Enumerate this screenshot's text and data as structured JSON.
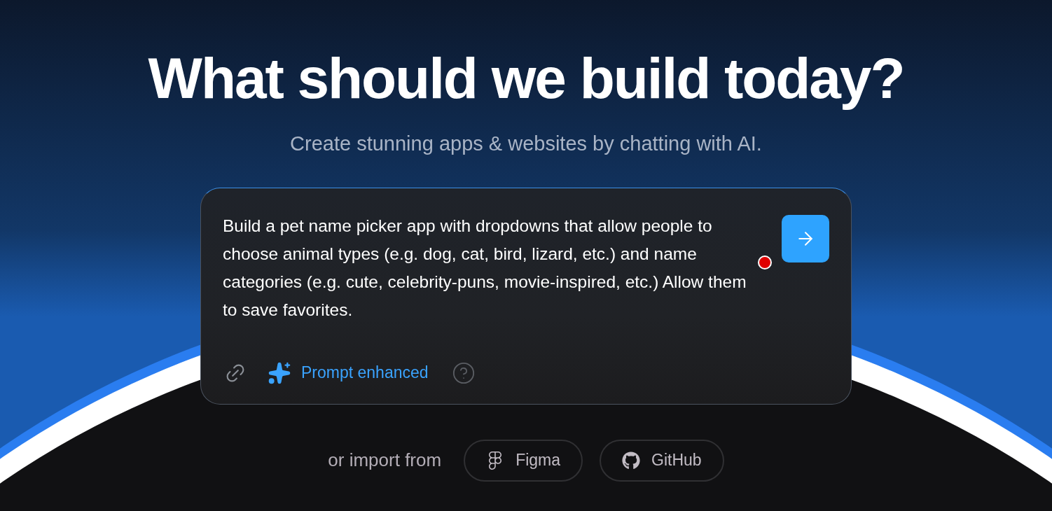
{
  "heading": "What should we build today?",
  "subheading": "Create stunning apps & websites by chatting with AI.",
  "prompt": {
    "value": "Build a pet name picker app with dropdowns that allow people to choose animal types (e.g. dog, cat, bird, lizard, etc.) and name categories (e.g. cute, celebrity-puns, movie-inspired, etc.) Allow them to save favorites.",
    "enhance_label": "Prompt enhanced"
  },
  "import": {
    "label": "or import from",
    "sources": [
      {
        "kind": "figma",
        "label": "Figma"
      },
      {
        "kind": "github",
        "label": "GitHub"
      }
    ]
  }
}
